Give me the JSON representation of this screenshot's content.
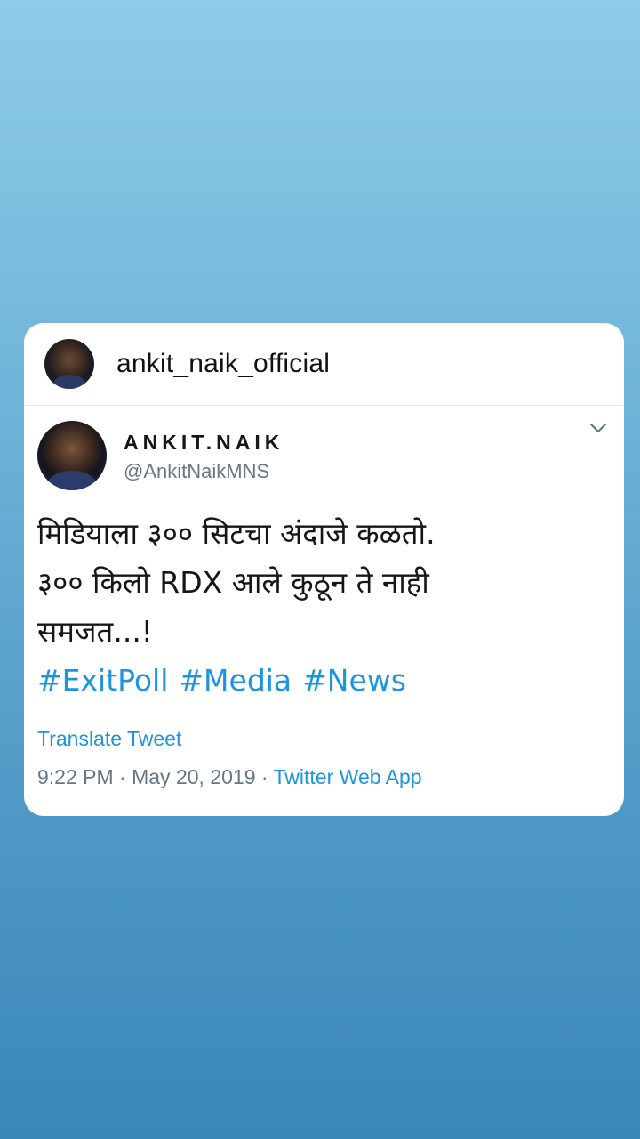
{
  "story": {
    "username": "ankit_naik_official"
  },
  "tweet": {
    "display_name": "ANKIT.NAIK",
    "handle": "@AnkitNaikMNS",
    "text_lines": [
      "मिडियाला ३०० सिटचा अंदाजे कळतो.",
      "३०० किलो RDX आले कुठून ते नाही",
      "समजत...!"
    ],
    "hashtags": [
      "#ExitPoll",
      "#Media",
      "#News"
    ],
    "translate_label": "Translate Tweet",
    "time": "9:22 PM",
    "separator": "·",
    "date": "May 20, 2019",
    "source": "Twitter Web App"
  },
  "colors": {
    "link": "#1b95e0",
    "secondary_text": "#657786",
    "primary_text": "#14171a"
  },
  "icons": {
    "menu": "chevron-down-icon"
  }
}
